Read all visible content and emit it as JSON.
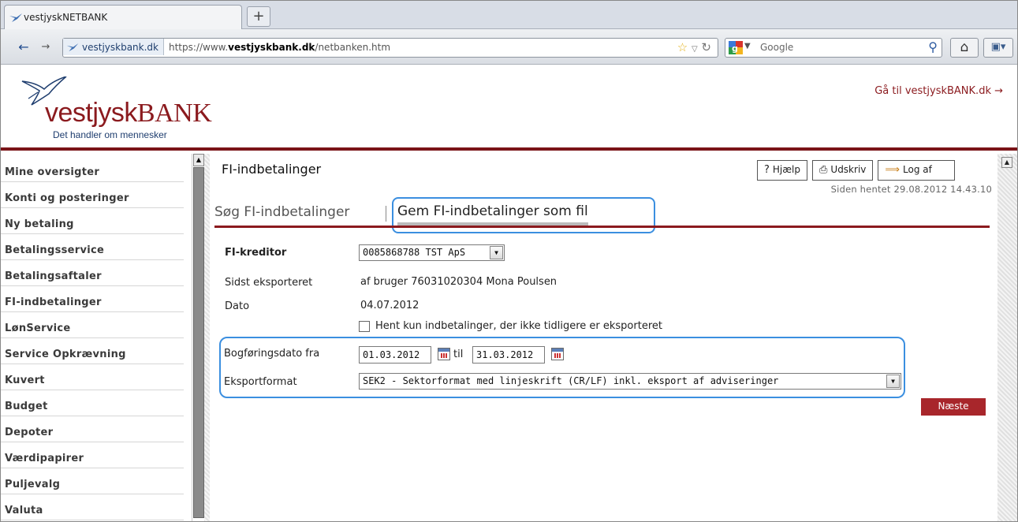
{
  "browser": {
    "tab_title": "vestjyskNETBANK",
    "new_tab": "+",
    "back": "←",
    "forward": "→",
    "site_identity": "vestjyskbank.dk",
    "url_prefix": "https://www.",
    "url_domain": "vestjyskbank.dk",
    "url_path": "/netbanken.htm",
    "search_placeholder": "Google"
  },
  "header": {
    "logo_name_part1": "vestjysk",
    "logo_name_part2": "BANK",
    "slogan": "Det handler om mennesker",
    "goto_link": "Gå til vestjyskBANK.dk →"
  },
  "sidebar": {
    "items": [
      {
        "label": "Mine oversigter"
      },
      {
        "label": "Konti og posteringer"
      },
      {
        "label": "Ny betaling"
      },
      {
        "label": "Betalingsservice"
      },
      {
        "label": "Betalingsaftaler"
      },
      {
        "label": "FI-indbetalinger"
      },
      {
        "label": "LønService"
      },
      {
        "label": "Service Opkrævning"
      },
      {
        "label": "Kuvert"
      },
      {
        "label": "Budget"
      },
      {
        "label": "Depoter"
      },
      {
        "label": "Værdipapirer"
      },
      {
        "label": "Puljevalg"
      },
      {
        "label": "Valuta"
      }
    ]
  },
  "main": {
    "title": "FI-indbetalinger",
    "toolbar": {
      "help": "Hjælp",
      "print": "Udskriv",
      "logout": "Log af"
    },
    "page_time": "Siden hentet 29.08.2012 14.43.10",
    "tabs": {
      "search": "Søg FI-indbetalinger",
      "save_file": "Gem FI-indbetalinger som fil"
    },
    "form": {
      "creditor_label": "FI-kreditor",
      "creditor_value": "0085868788 TST ApS",
      "last_exported_label": "Sidst eksporteret",
      "last_exported_value": "af bruger 76031020304 Mona Poulsen",
      "date_label": "Dato",
      "date_value": "04.07.2012",
      "only_new_label": "Hent kun indbetalinger, der ikke tidligere er eksporteret",
      "booking_date_label": "Bogføringsdato fra",
      "date_from": "01.03.2012",
      "til": "til",
      "date_to": "31.03.2012",
      "format_label": "Eksportformat",
      "format_value": "SEK2 - Sektorformat med linjeskrift (CR/LF) inkl. eksport af adviseringer"
    },
    "next_button": "Næste"
  },
  "colors": {
    "brand_red": "#8b1a1e",
    "next_button": "#a8262b",
    "highlight_blue": "#3b8fe0"
  }
}
